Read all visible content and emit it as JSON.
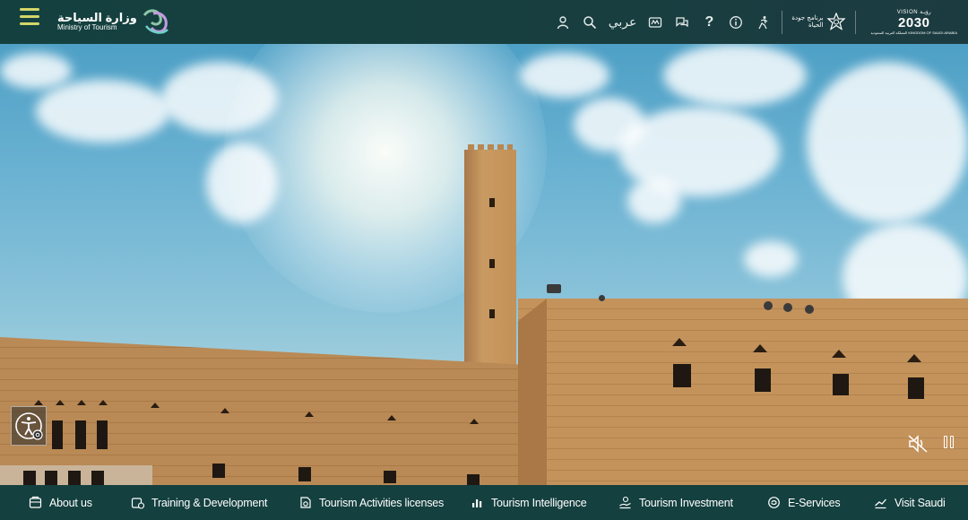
{
  "header": {
    "logo_ar": "وزارة السياحة",
    "logo_en": "Ministry of Tourism",
    "lang_label": "عربي",
    "qol_text_line1": "برنامج جودة",
    "qol_text_line2": "الحياة",
    "vision_top": "VISION رؤيـة",
    "vision_num": "2030",
    "vision_bottom": "المملكة العربية السعودية KINGDOM OF SAUDI ARABIA",
    "icons": [
      "user-icon",
      "search-icon",
      "language-toggle",
      "sign-language-icon",
      "chat-icon",
      "help-icon",
      "info-icon",
      "accessibility-run-icon"
    ]
  },
  "nav": {
    "items": [
      {
        "label": "About us",
        "icon": "info-box-icon"
      },
      {
        "label": "Training & Development",
        "icon": "training-icon"
      },
      {
        "label": "Tourism Activities licenses",
        "icon": "license-icon"
      },
      {
        "label": "Tourism Intelligence",
        "icon": "bar-chart-icon"
      },
      {
        "label": "Tourism Investment",
        "icon": "investment-icon"
      },
      {
        "label": "E-Services",
        "icon": "eservices-icon"
      },
      {
        "label": "Visit Saudi",
        "icon": "visit-icon"
      }
    ]
  },
  "colors": {
    "header_bg": "#173f3f",
    "nav_bg": "#14403f",
    "hamburger": "#d4d66a"
  }
}
